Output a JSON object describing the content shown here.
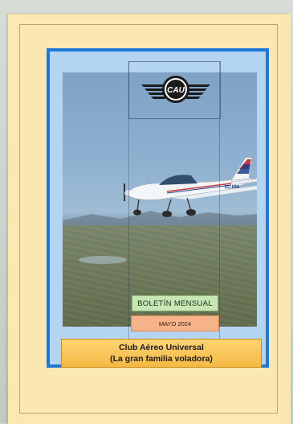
{
  "cover": {
    "logo_text": "CAU",
    "aircraft_registration": "EC-MMI",
    "newsletter_label": "BOLETÍN MENSUAL",
    "date_label": "MAYO 2024",
    "title_line1": "Club Aéreo Universal",
    "title_line2": "(La gran familia voladora)"
  },
  "colors": {
    "page": "#fbe8b0",
    "frame": "#1f78d6",
    "monthly_badge": "#c6e7b4",
    "date_badge": "#f6b38a",
    "title_box": "#f4b942"
  }
}
